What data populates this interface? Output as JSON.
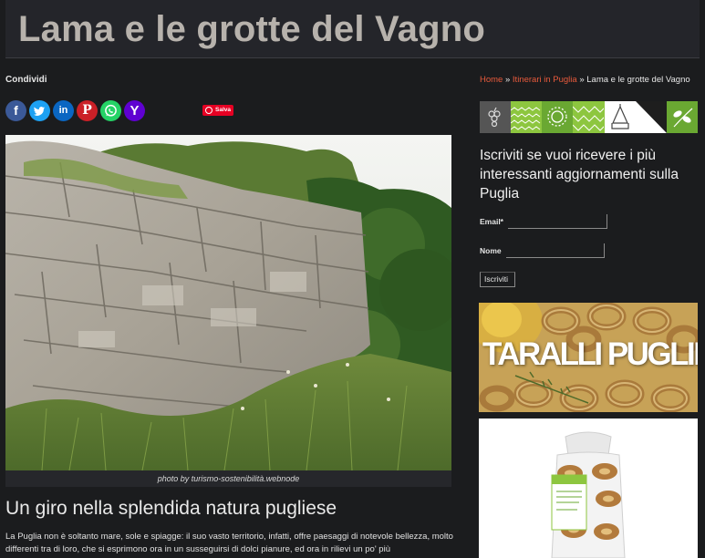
{
  "header": {
    "title": "Lama e le grotte del Vagno"
  },
  "share": {
    "label": "Condividi",
    "buttons": [
      {
        "name": "facebook",
        "glyph": "f",
        "color": "#3b5998"
      },
      {
        "name": "twitter",
        "glyph": "t",
        "color": "#1da1f2"
      },
      {
        "name": "linkedin",
        "glyph": "in",
        "color": "#0a66c2"
      },
      {
        "name": "pinterest",
        "glyph": "P",
        "color": "#cb2027"
      },
      {
        "name": "whatsapp",
        "glyph": "w",
        "color": "#25d366"
      },
      {
        "name": "yahoo",
        "glyph": "Y",
        "color": "#5f01d1"
      }
    ],
    "pin_save_label": "Salva"
  },
  "hero": {
    "caption": "photo by turismo-sostenibilità.webnode"
  },
  "article": {
    "heading": "Un giro nella splendida natura pugliese",
    "paragraph": "La Puglia non è soltanto mare, sole e spiagge: il suo vasto territorio, infatti, offre paesaggi di notevole bellezza, molto differenti tra di loro, che si esprimono ora in un susseguirsi di dolci pianure, ed ora in rilievi un po' più"
  },
  "breadcrumb": {
    "home": "Home",
    "separator": "»",
    "section": "Itinerari in Puglia",
    "current": "Lama e le grotte del Vagno"
  },
  "banner_colors": [
    "#555555",
    "#8dc63f",
    "#6aa832",
    "#8dc63f",
    "#ffffff",
    "#1e1e1e",
    "#6aa832"
  ],
  "newsletter": {
    "title": "Iscriviti se vuoi ricevere i più interessanti aggiornamenti sulla Puglia",
    "email_label": "Email*",
    "name_label": "Nome",
    "submit_label": "Iscriviti"
  },
  "ads": {
    "taralli_text": "TARALLI PUGLIESI"
  }
}
